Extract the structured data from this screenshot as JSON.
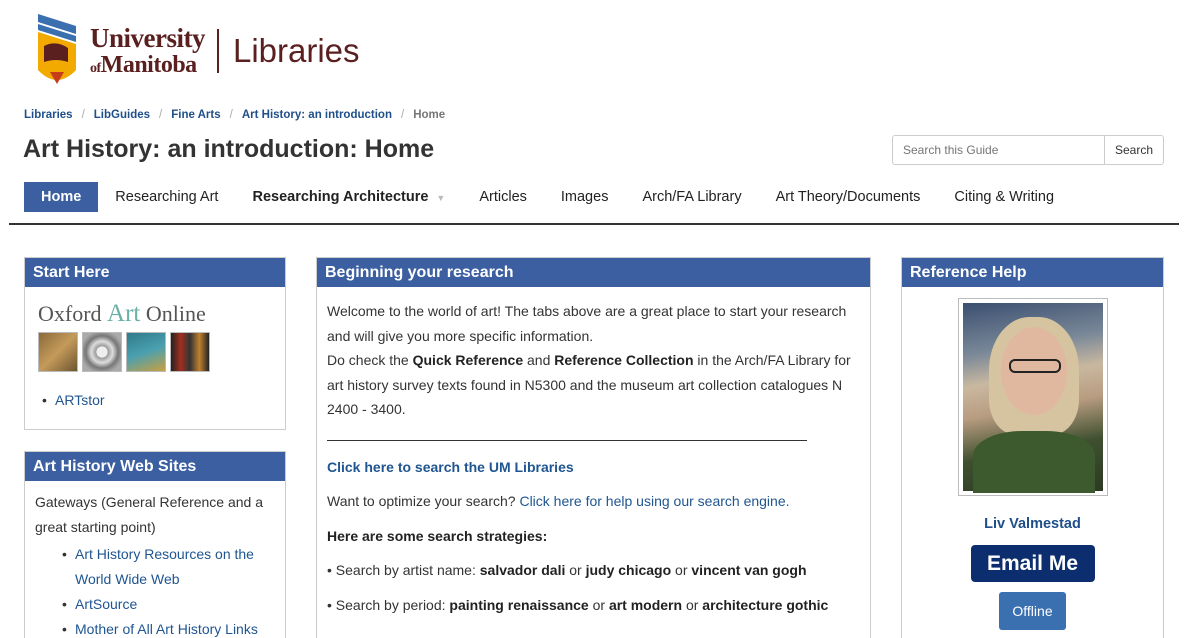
{
  "header": {
    "logo": {
      "line1": "University",
      "line2_prefix": "of",
      "line2": "Manitoba",
      "libraries": "Libraries"
    }
  },
  "breadcrumb": [
    "Libraries",
    "LibGuides",
    "Fine Arts",
    "Art History: an introduction",
    "Home"
  ],
  "page_title": "Art History: an introduction: Home",
  "search": {
    "placeholder": "Search this Guide",
    "button": "Search"
  },
  "tabs": [
    {
      "label": "Home",
      "active": true
    },
    {
      "label": "Researching Art"
    },
    {
      "label": "Researching Architecture",
      "has_dropdown": true
    },
    {
      "label": "Articles"
    },
    {
      "label": "Images"
    },
    {
      "label": "Arch/FA Library"
    },
    {
      "label": "Art Theory/Documents"
    },
    {
      "label": "Citing & Writing"
    }
  ],
  "start_here": {
    "title": "Start Here",
    "oxford": {
      "pre": "Oxford ",
      "art": "Art",
      "post": " Online"
    },
    "links": [
      "ARTstor"
    ]
  },
  "web_sites": {
    "title": "Art History Web Sites",
    "intro": "Gateways (General Reference and a great starting point)",
    "links": [
      "Art History Resources on the World Wide Web",
      "ArtSource",
      "Mother of All Art History Links"
    ]
  },
  "main": {
    "title": "Beginning your research",
    "p1": "Welcome to the world of art!  The tabs above are a great place to start your research and will give you more specific information.",
    "p2_a": "Do check the ",
    "p2_b": "Quick Reference",
    "p2_c": " and ",
    "p2_d": "Reference Collection",
    "p2_e": " in the Arch/FA Library for art history survey texts found in N5300 and the museum art collection catalogues N 2400 - 3400.",
    "search_link": "Click here to search the UM Libraries",
    "optimize_prefix": "Want to optimize your search? ",
    "optimize_link": "Click here for help using our search engine.",
    "strategies_heading": "Here are some search strategies:",
    "s1": {
      "prefix": "• Search by artist name: ",
      "a": "salvador dali",
      "or1": " or  ",
      "b": "judy chicago",
      "or2": " or ",
      "c": "vincent  van gogh"
    },
    "s2": {
      "prefix": "• Search by period: ",
      "a": "painting renaissance",
      "or1": " or ",
      "b": "art modern",
      "or2": " or  ",
      "c": "architecture gothic"
    }
  },
  "reference": {
    "title": "Reference Help",
    "name": "Liv Valmestad",
    "email_button": "Email Me",
    "status_button": "Offline"
  },
  "colors": {
    "header_blue": "#3b5fa0",
    "link_blue": "#1f5590",
    "brand_brown": "#5a1f1f",
    "email_navy": "#0d2e6e"
  }
}
